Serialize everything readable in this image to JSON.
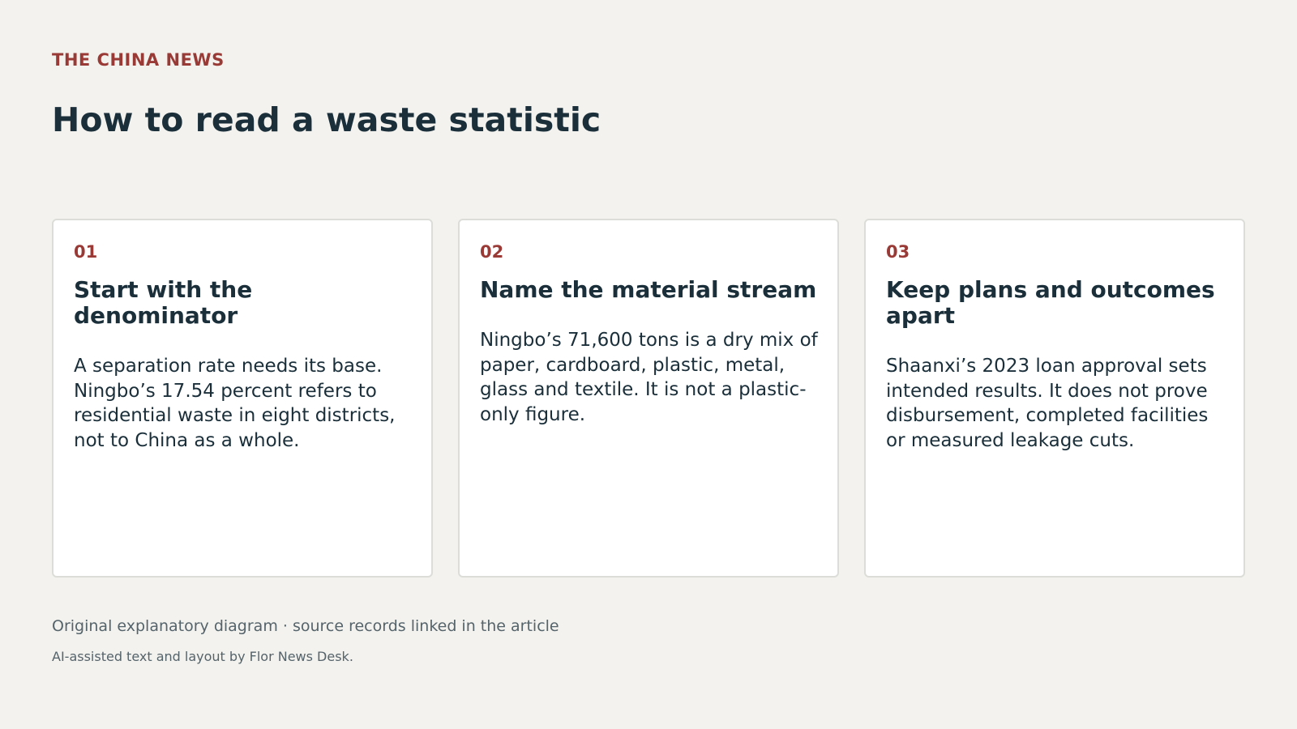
{
  "header": {
    "brand": "THE CHINA NEWS",
    "title": "How to read a waste statistic"
  },
  "cards": [
    {
      "number": "01",
      "title": "Start with the denominator",
      "text": "A separation rate needs its base. Ningbo’s 17.54 percent refers to residential waste in eight districts, not to China as a whole."
    },
    {
      "number": "02",
      "title": "Name the material stream",
      "text": "Ningbo’s 71,600 tons is a dry mix of paper, cardboard, plastic, metal, glass and textile. It is not a plastic-only figure."
    },
    {
      "number": "03",
      "title": "Keep plans and outcomes apart",
      "text": "Shaanxi’s 2023 loan approval sets intended results. It does not prove disbursement, completed facilities or measured leakage cuts."
    }
  ],
  "footer": {
    "source_note": "Original explanatory diagram · source records linked in the article",
    "credit": "AI-assisted text and layout by Flor News Desk."
  },
  "colors": {
    "background": "#f3f2ee",
    "accent": "#9a3a36",
    "heading": "#1a2f3a",
    "muted": "#55636b",
    "card_background": "#ffffff",
    "card_border": "#dcdcd8"
  }
}
